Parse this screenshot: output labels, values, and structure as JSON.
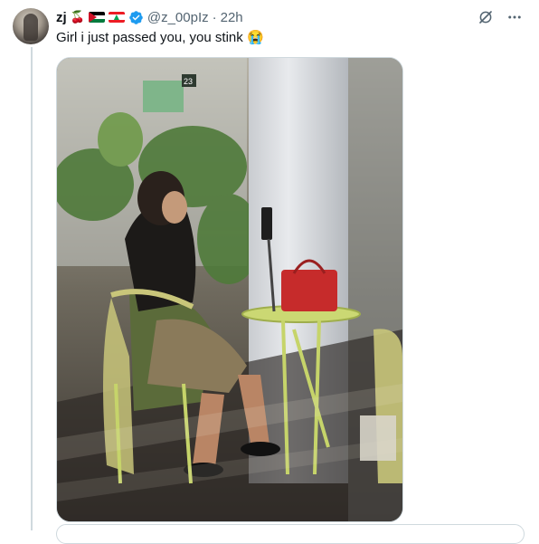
{
  "tweet": {
    "display_name": "zj",
    "name_emoji": "🍒",
    "handle": "@z_00pIz",
    "separator": "·",
    "timestamp": "22h",
    "text": "Girl i just passed you, you stink",
    "text_emoji": "😭"
  },
  "icons": {
    "verified": "verified-badge-icon",
    "grok": "grok-icon",
    "more": "more-options-icon"
  },
  "colors": {
    "verified_blue": "#1d9bf0",
    "secondary_text": "#536471",
    "border": "#cfd9de"
  }
}
